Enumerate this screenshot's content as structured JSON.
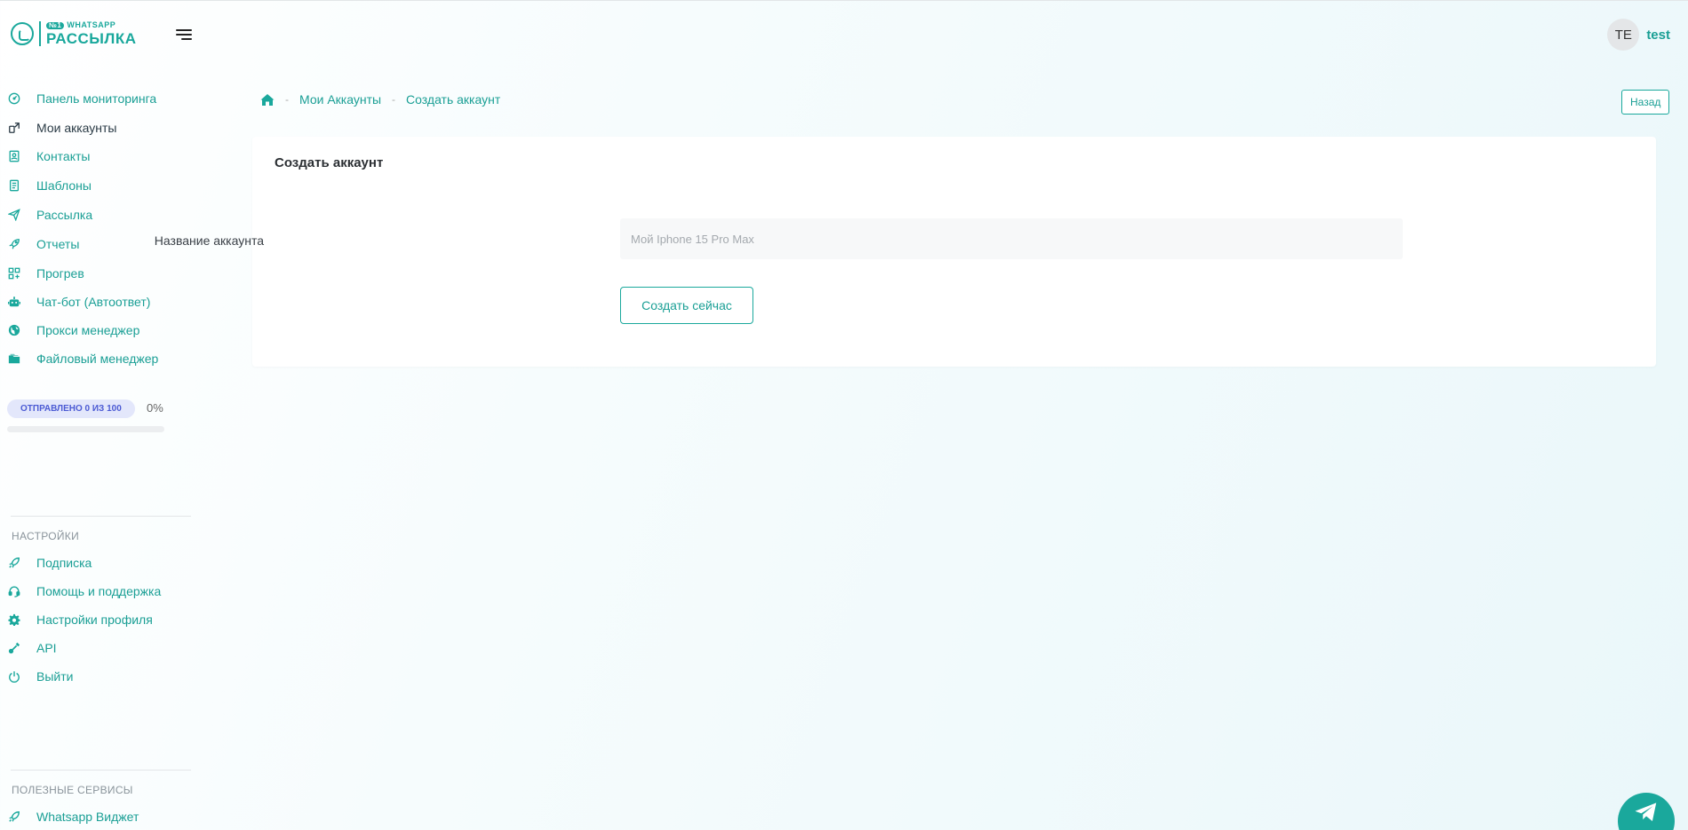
{
  "brand": {
    "logo_top": "WHATSAPP",
    "logo_badge": "№1",
    "logo_bottom": "РАССЫЛКА",
    "color": "#1aa89c"
  },
  "header": {
    "avatar_initials": "TE",
    "user_name": "test"
  },
  "sidebar": {
    "main_items": [
      {
        "label": "Панель мониторинга",
        "icon": "dashboard-icon"
      },
      {
        "label": "Мои аккаунты",
        "icon": "accounts-icon",
        "active": true
      },
      {
        "label": "Контакты",
        "icon": "contacts-icon"
      },
      {
        "label": "Шаблоны",
        "icon": "templates-icon"
      },
      {
        "label": "Рассылка",
        "icon": "send-icon"
      },
      {
        "label": "Отчеты",
        "icon": "reports-icon"
      },
      {
        "label": "Прогрев",
        "icon": "warmup-icon"
      },
      {
        "label": "Чат-бот (Автоответ)",
        "icon": "robot-icon"
      },
      {
        "label": "Прокси менеджер",
        "icon": "globe-icon"
      },
      {
        "label": "Файловый менеджер",
        "icon": "folder-icon"
      }
    ],
    "sent": {
      "label": "ОТПРАВЛЕНО 0 ИЗ 100",
      "percent_text": "0%",
      "progress": 0
    },
    "settings_head": "НАСТРОЙКИ",
    "settings_items": [
      {
        "label": "Подписка",
        "icon": "rocket-icon"
      },
      {
        "label": "Помощь и поддержка",
        "icon": "headset-icon"
      },
      {
        "label": "Настройки профиля",
        "icon": "gear-icon"
      },
      {
        "label": "API",
        "icon": "plug-icon"
      },
      {
        "label": "Выйти",
        "icon": "power-icon"
      }
    ],
    "services_head": "ПОЛЕЗНЫЕ СЕРВИСЫ",
    "services_items": [
      {
        "label": "Whatsapp Виджет",
        "icon": "rocket-icon"
      }
    ]
  },
  "breadcrumb": {
    "home_icon": "home-icon",
    "items": [
      "Мои Аккаунты",
      "Создать аккаунт"
    ]
  },
  "back_button": "Назад",
  "form": {
    "title": "Создать аккаунт",
    "field_label": "Название аккаунта",
    "field_placeholder": "Мой Iphone 15 Pro Max",
    "field_value": "",
    "submit_label": "Создать сейчас"
  },
  "fab": {
    "icon": "telegram-icon"
  }
}
